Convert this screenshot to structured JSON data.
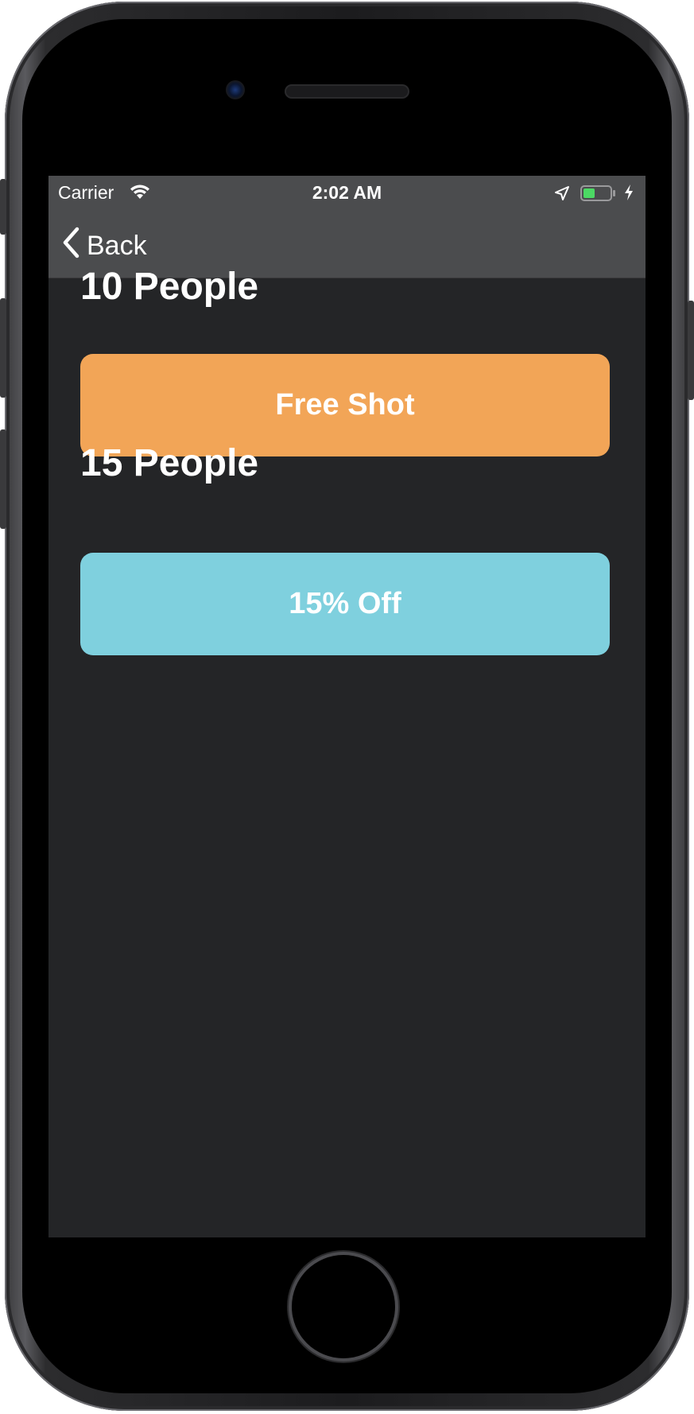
{
  "status_bar": {
    "carrier": "Carrier",
    "time": "2:02 AM",
    "battery_color": "#4cd964"
  },
  "nav": {
    "back_label": "Back",
    "back_icon": "chevron-left-icon"
  },
  "tiers": [
    {
      "title": "10 People",
      "reward": "Free Shot",
      "color": "#f2a557"
    },
    {
      "title": "15 People",
      "reward": "15% Off",
      "color": "#7fd0de"
    }
  ],
  "colors": {
    "screen_bg": "#242527",
    "bar_bg": "#4b4c4e"
  }
}
